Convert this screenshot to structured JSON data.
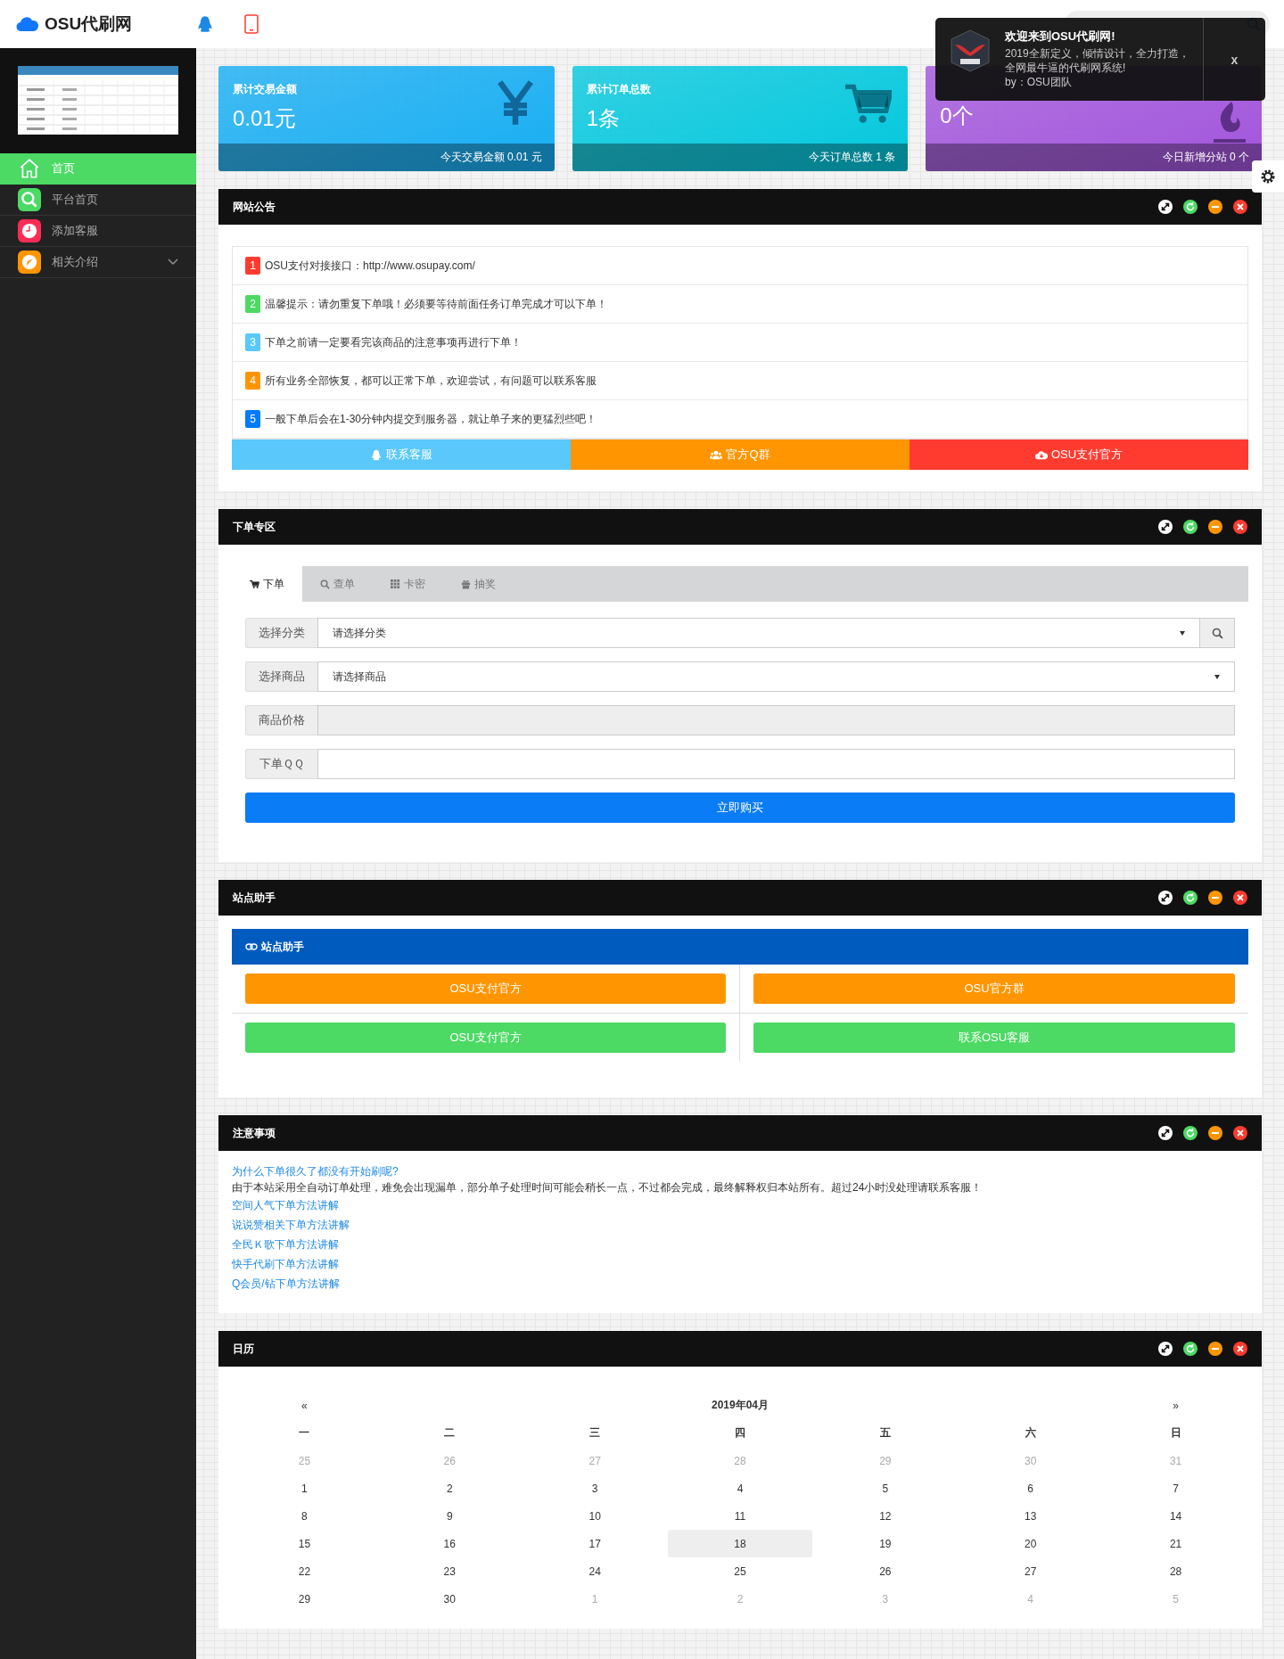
{
  "header": {
    "brand": "OSU代刷网"
  },
  "sidebar": {
    "items": [
      {
        "label": "首页",
        "kind": "home",
        "selected": true,
        "has_children": false
      },
      {
        "label": "平台首页",
        "kind": "search",
        "selected": false,
        "has_children": false
      },
      {
        "label": "添加客服",
        "kind": "clock",
        "selected": false,
        "has_children": false
      },
      {
        "label": "相关介绍",
        "kind": "compass",
        "selected": false,
        "has_children": true
      }
    ]
  },
  "stats": [
    {
      "title": "累计交易金额",
      "value": "0.01元",
      "footer": "今天交易金额 0.01 元",
      "color": "#17aef3",
      "kind": "yen"
    },
    {
      "title": "累计订单总数",
      "value": "1条",
      "footer": "今天订单总数 1 条",
      "color": "#03c8de",
      "kind": "cart"
    },
    {
      "value": "0个",
      "footer": "今日新增分站 0 个",
      "color": "#a255dc",
      "kind": "fire"
    }
  ],
  "toast": {
    "title": "欢迎来到OSU代刷网!",
    "lines": [
      "2019全新定义，倾情设计，全力打造，",
      "全网最牛逼的代刷网系统!"
    ],
    "signature": "by：OSU团队",
    "close": "x"
  },
  "notice": {
    "title": "网站公告",
    "items": [
      {
        "number": "1",
        "text": "OSU支付对接接口：http://www.osupay.com/",
        "color": "#ff3b30"
      },
      {
        "number": "2",
        "text": "温馨提示：请勿重复下单哦！必须要等待前面任务订单完成才可以下单！",
        "color": "#4cd964"
      },
      {
        "number": "3",
        "text": "下单之前请一定要看完该商品的注意事项再进行下单！",
        "color": "#5ac8fa"
      },
      {
        "number": "4",
        "text": "所有业务全部恢复，都可以正常下单，欢迎尝试，有问题可以联系客服",
        "color": "#ff9500"
      },
      {
        "number": "5",
        "text": "一般下单后会在1-30分钟内提交到服务器，就让单子来的更猛烈些吧！",
        "color": "#007aff"
      }
    ],
    "buttons": [
      {
        "label": "联系客服",
        "kind": "qq",
        "color": "#5ac8fa"
      },
      {
        "label": "官方Q群",
        "kind": "group",
        "color": "#ff9500"
      },
      {
        "label": "OSU支付官方",
        "kind": "cloud",
        "color": "#ff3b30"
      }
    ]
  },
  "order": {
    "title": "下单专区",
    "tabs": [
      {
        "label": "下单",
        "kind": "cart",
        "selected": true
      },
      {
        "label": "查单",
        "kind": "search",
        "selected": false
      },
      {
        "label": "卡密",
        "kind": "grid",
        "selected": false
      },
      {
        "label": "抽奖",
        "kind": "gift",
        "selected": false
      }
    ],
    "fields": [
      {
        "label": "选择分类",
        "kind": "select",
        "value": "请选择分类",
        "search_button": true
      },
      {
        "label": "选择商品",
        "kind": "select",
        "value": "请选择商品",
        "search_button": false
      },
      {
        "label": "商品价格",
        "kind": "readonly"
      },
      {
        "label": "下单ＱＱ",
        "kind": "input"
      }
    ],
    "submit": "立即购买"
  },
  "helper": {
    "title": "站点助手",
    "subtitle": "站点助手",
    "buttons": [
      {
        "label": "OSU支付官方",
        "color": "#ff9500"
      },
      {
        "label": "OSU官方群",
        "color": "#ff9500"
      },
      {
        "label": "OSU支付官方",
        "color": "#4cd964"
      },
      {
        "label": "联系OSU客服",
        "color": "#4cd964"
      }
    ]
  },
  "notes": {
    "title": "注意事项",
    "question": "为什么下单很久了都没有开始刷呢?",
    "answer": "由于本站采用全自动订单处理，难免会出现漏单，部分单子处理时间可能会稍长一点，不过都会完成，最终解释权归本站所有。超过24小时没处理请联系客服！",
    "links": [
      "空间人气下单方法讲解",
      "说说赞相关下单方法讲解",
      "全民Ｋ歌下单方法讲解",
      "快手代刷下单方法讲解",
      "Q会员/钻下单方法讲解"
    ]
  },
  "calendar": {
    "title": "日历",
    "prev": "«",
    "month": "2019年04月",
    "next": "»",
    "weekdays": [
      "一",
      "二",
      "三",
      "四",
      "五",
      "六",
      "日"
    ],
    "weeks": [
      [
        {
          "day": "25",
          "muted": true,
          "selected": false
        },
        {
          "day": "26",
          "muted": true,
          "selected": false
        },
        {
          "day": "27",
          "muted": true,
          "selected": false
        },
        {
          "day": "28",
          "muted": true,
          "selected": false
        },
        {
          "day": "29",
          "muted": true,
          "selected": false
        },
        {
          "day": "30",
          "muted": true,
          "selected": false
        },
        {
          "day": "31",
          "muted": true,
          "selected": false
        }
      ],
      [
        {
          "day": "1",
          "muted": false,
          "selected": false
        },
        {
          "day": "2",
          "muted": false,
          "selected": false
        },
        {
          "day": "3",
          "muted": false,
          "selected": false
        },
        {
          "day": "4",
          "muted": false,
          "selected": false
        },
        {
          "day": "5",
          "muted": false,
          "selected": false
        },
        {
          "day": "6",
          "muted": false,
          "selected": false
        },
        {
          "day": "7",
          "muted": false,
          "selected": false
        }
      ],
      [
        {
          "day": "8",
          "muted": false,
          "selected": false
        },
        {
          "day": "9",
          "muted": false,
          "selected": false
        },
        {
          "day": "10",
          "muted": false,
          "selected": false
        },
        {
          "day": "11",
          "muted": false,
          "selected": false
        },
        {
          "day": "12",
          "muted": false,
          "selected": false
        },
        {
          "day": "13",
          "muted": false,
          "selected": false
        },
        {
          "day": "14",
          "muted": false,
          "selected": false
        }
      ],
      [
        {
          "day": "15",
          "muted": false,
          "selected": false
        },
        {
          "day": "16",
          "muted": false,
          "selected": false
        },
        {
          "day": "17",
          "muted": false,
          "selected": false
        },
        {
          "day": "18",
          "muted": false,
          "selected": true
        },
        {
          "day": "19",
          "muted": false,
          "selected": false
        },
        {
          "day": "20",
          "muted": false,
          "selected": false
        },
        {
          "day": "21",
          "muted": false,
          "selected": false
        }
      ],
      [
        {
          "day": "22",
          "muted": false,
          "selected": false
        },
        {
          "day": "23",
          "muted": false,
          "selected": false
        },
        {
          "day": "24",
          "muted": false,
          "selected": false
        },
        {
          "day": "25",
          "muted": false,
          "selected": false
        },
        {
          "day": "26",
          "muted": false,
          "selected": false
        },
        {
          "day": "27",
          "muted": false,
          "selected": false
        },
        {
          "day": "28",
          "muted": false,
          "selected": false
        }
      ],
      [
        {
          "day": "29",
          "muted": false,
          "selected": false
        },
        {
          "day": "30",
          "muted": false,
          "selected": false
        },
        {
          "day": "1",
          "muted": true,
          "selected": false
        },
        {
          "day": "2",
          "muted": true,
          "selected": false
        },
        {
          "day": "3",
          "muted": true,
          "selected": false
        },
        {
          "day": "4",
          "muted": true,
          "selected": false
        },
        {
          "day": "5",
          "muted": true,
          "selected": false
        }
      ]
    ]
  }
}
